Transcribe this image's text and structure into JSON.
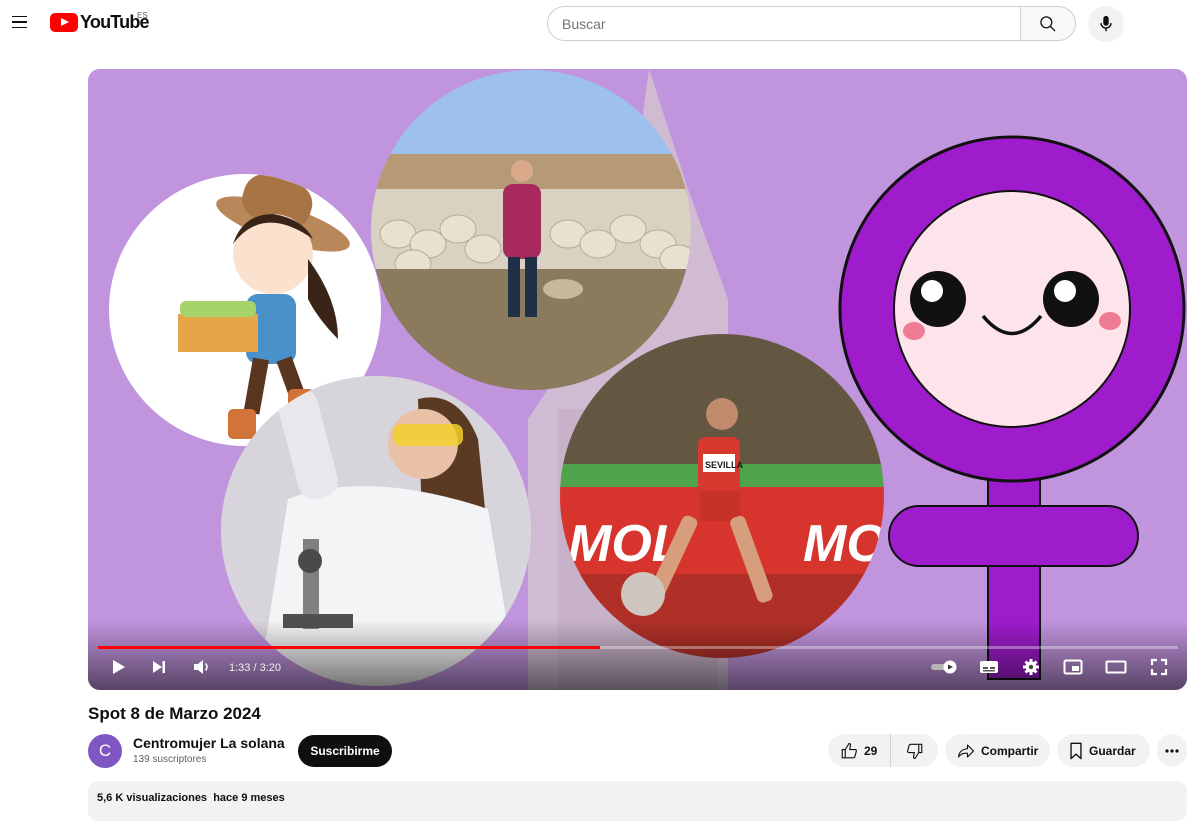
{
  "header": {
    "logo_text": "YouTube",
    "region_code": "ES",
    "search_placeholder": "Buscar"
  },
  "player": {
    "current_time": "1:33",
    "duration": "3:20",
    "time_display": "1:33 / 3:20",
    "progress_fraction": 0.465,
    "thumbnail": {
      "background_color": "#c194de",
      "jersey_text": "SEVILLA",
      "track_banner_text": "MOL",
      "track_banner_text_2": "MO"
    }
  },
  "video": {
    "title": "Spot 8 de Marzo 2024",
    "channel": {
      "avatar_letter": "C",
      "name": "Centromujer La solana",
      "subscribers": "139 suscriptores",
      "subscribe_label": "Suscribirme"
    },
    "actions": {
      "like_count": "29",
      "share_label": "Compartir",
      "save_label": "Guardar"
    },
    "description": {
      "views": "5,6 K visualizaciones",
      "published": "hace 9 meses"
    }
  },
  "colors": {
    "accent_red": "#ff0000",
    "female_symbol": "#9e1ccc",
    "avatar_bg": "#7e57c2"
  }
}
